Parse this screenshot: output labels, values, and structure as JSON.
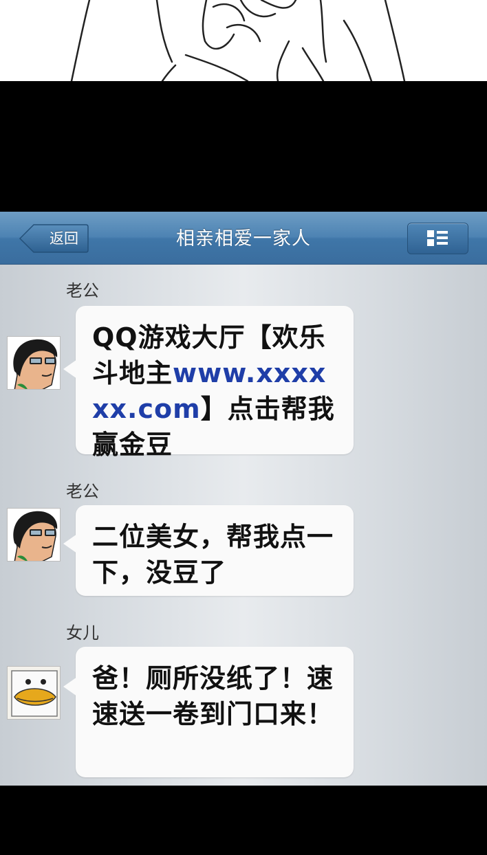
{
  "nav": {
    "back_label": "返回",
    "title": "相亲相爱一家人"
  },
  "messages": [
    {
      "sender": "老公",
      "avatar": "man-with-glasses-avatar",
      "text_before": "QQ游戏大厅【欢乐斗地主",
      "link": "www.xxxxxx.com",
      "text_after": "】点击帮我赢金豆"
    },
    {
      "sender": "老公",
      "avatar": "man-with-glasses-avatar",
      "text": "二位美女，帮我点一下，没豆了"
    },
    {
      "sender": "女儿",
      "avatar": "duck-avatar",
      "text": "爸！厕所没纸了！速速送一卷到门口来！"
    }
  ],
  "colors": {
    "navbar": "#4d83b3",
    "bubble": "#fafafa",
    "link": "#1f3ea8"
  }
}
